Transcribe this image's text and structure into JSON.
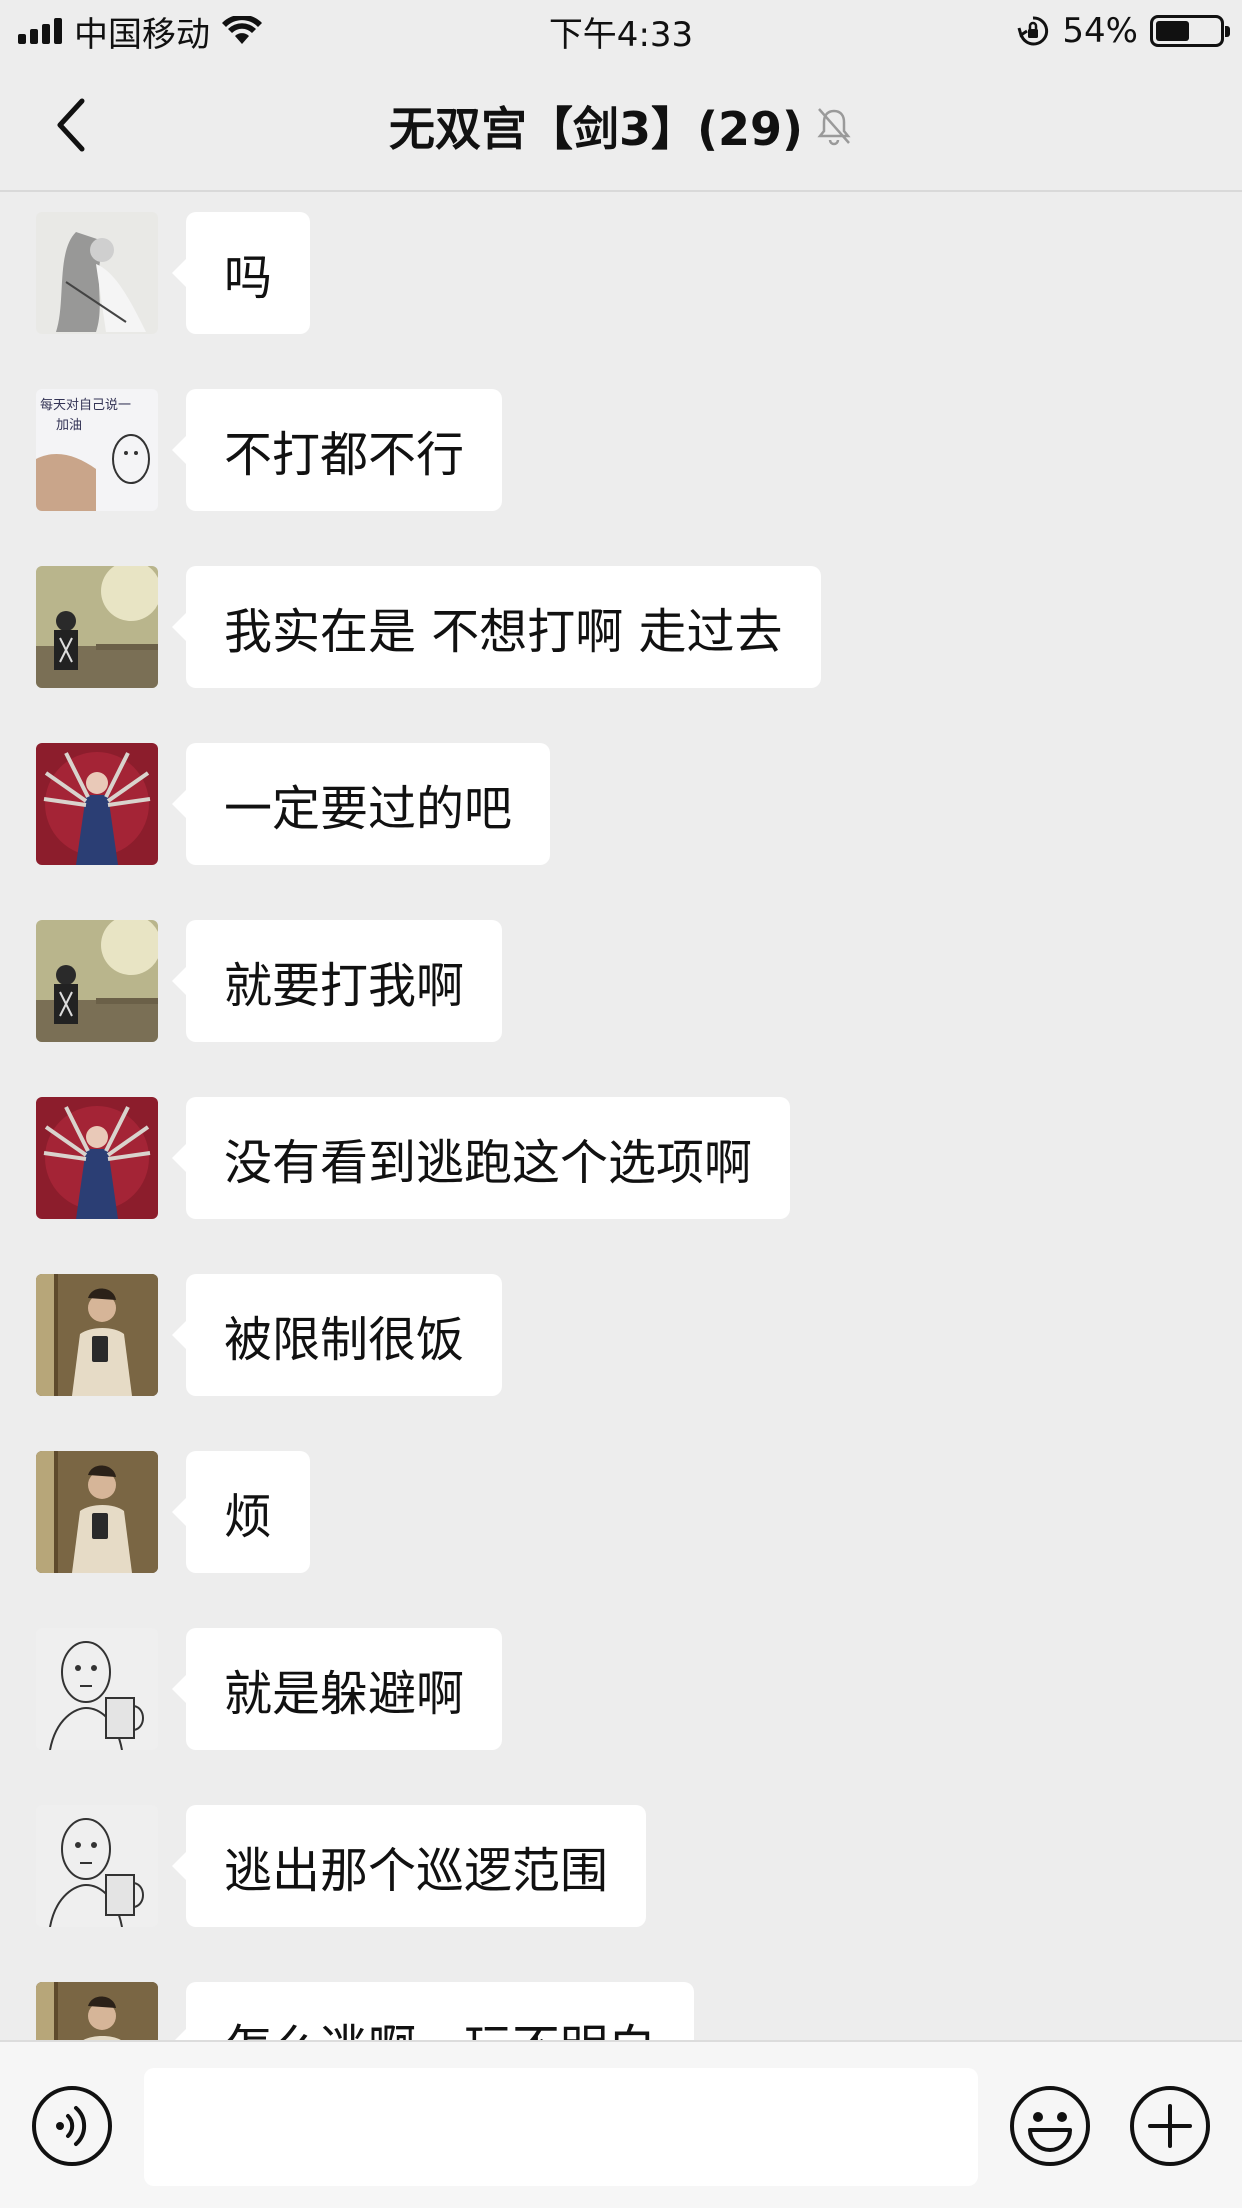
{
  "status_bar": {
    "carrier": "中国移动",
    "time": "下午4:33",
    "battery_percent": "54%",
    "battery_level": 0.54,
    "icons": [
      "signal-icon",
      "wifi-icon",
      "orientation-lock-icon",
      "battery-icon"
    ]
  },
  "nav": {
    "title": "无双宫【剑3】(29)",
    "back_icon": "chevron-left-icon",
    "mute_icon": "bell-muted-icon"
  },
  "messages": [
    {
      "text": "吗",
      "avatar": "avatar-ink-painting"
    },
    {
      "text": "不打都不行",
      "avatar": "avatar-hand-drawing"
    },
    {
      "text": "我实在是 不想打啊 走过去",
      "avatar": "avatar-outdoor-guy"
    },
    {
      "text": "一定要过的吧",
      "avatar": "avatar-red-multiarm"
    },
    {
      "text": "就要打我啊",
      "avatar": "avatar-outdoor-guy"
    },
    {
      "text": "没有看到逃跑这个选项啊",
      "avatar": "avatar-red-multiarm"
    },
    {
      "text": "被限制很饭",
      "avatar": "avatar-mirror-selfie"
    },
    {
      "text": "烦",
      "avatar": "avatar-mirror-selfie"
    },
    {
      "text": "就是躲避啊",
      "avatar": "avatar-sketch-beer"
    },
    {
      "text": "逃出那个巡逻范围",
      "avatar": "avatar-sketch-beer"
    },
    {
      "text": "怎么逃啊，玩不明白",
      "avatar": "avatar-mirror-selfie"
    }
  ],
  "input_bar": {
    "voice_icon": "voice-icon",
    "text_value": "",
    "emoji_icon": "emoji-icon",
    "plus_icon": "plus-icon"
  },
  "colors": {
    "background": "#ededed",
    "bubble": "#ffffff",
    "input_bar": "#f6f6f6",
    "text": "#111111"
  }
}
